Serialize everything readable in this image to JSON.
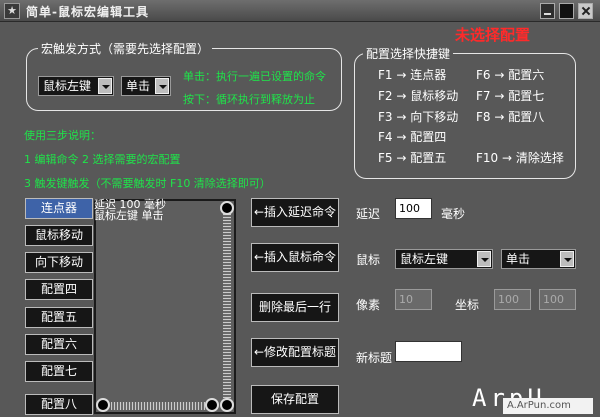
{
  "window": {
    "title": "简单-鼠标宏编辑工具",
    "app_icon": "★"
  },
  "status": {
    "text": "未选择配置",
    "color": "#ff2a2a"
  },
  "trigger": {
    "group_title": "宏触发方式（需要先选择配置）",
    "mouse_button": "鼠标左键",
    "click_mode": "单击",
    "help_line1": "单击：执行一遍已设置的命令",
    "help_line2": "按下：循环执行到释放为止"
  },
  "instructions": {
    "title": "使用三步说明：",
    "line1": "1 编辑命令    2 选择需要的宏配置",
    "line2": "3 触发键触发（不需要触发时 F10 清除选择即可）"
  },
  "shortcuts": {
    "group_title": "配置选择快捷键",
    "arrow": "→",
    "items": [
      {
        "key": "F1",
        "label": "连点器"
      },
      {
        "key": "F2",
        "label": "鼠标移动"
      },
      {
        "key": "F3",
        "label": "向下移动"
      },
      {
        "key": "F4",
        "label": "配置四"
      },
      {
        "key": "F5",
        "label": "配置五"
      },
      {
        "key": "F6",
        "label": "配置六"
      },
      {
        "key": "F7",
        "label": "配置七"
      },
      {
        "key": "F8",
        "label": "配置八"
      },
      {
        "key": "F10",
        "label": "清除选择"
      }
    ]
  },
  "configs": [
    "连点器",
    "鼠标移动",
    "向下移动",
    "配置四",
    "配置五",
    "配置六",
    "配置七",
    "配置八"
  ],
  "selected_config": "连点器",
  "command_list": [
    "延迟 100 毫秒",
    "鼠标左键 单击"
  ],
  "commands": {
    "insert_delay": "←插入延迟命令",
    "insert_mouse": "←插入鼠标命令",
    "delete_last": "删除最后一行",
    "rename": "←修改配置标题",
    "save": "保存配置"
  },
  "form": {
    "delay_label": "延迟",
    "delay_value": "100",
    "delay_unit": "毫秒",
    "mouse_label": "鼠标",
    "mouse_button": "鼠标左键",
    "mouse_action": "单击",
    "pixel_label": "像素",
    "pixel_value": "10",
    "coord_label": "坐标",
    "coord_x": "100",
    "coord_y": "100",
    "newtitle_label": "新标题",
    "newtitle_value": ""
  },
  "watermark": {
    "text": "ArpU",
    "sub": "A.ArPun.com"
  }
}
